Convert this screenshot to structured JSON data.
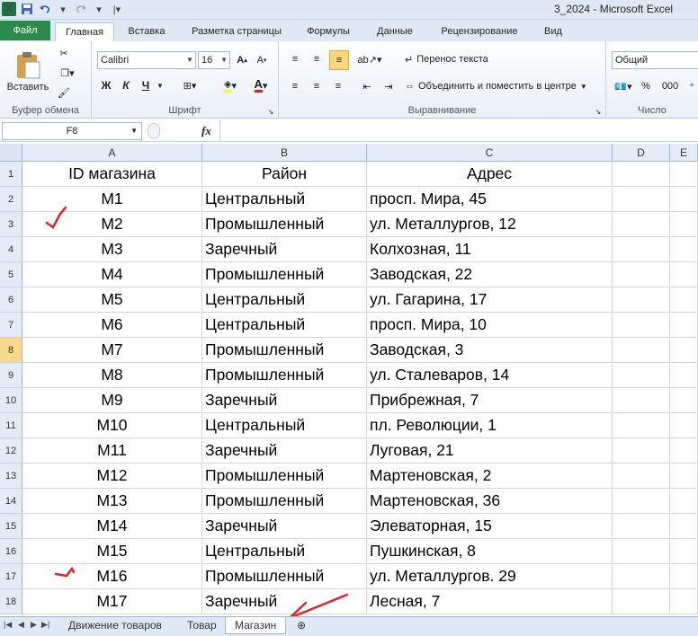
{
  "window": {
    "title": "3_2024  -  Microsoft Excel"
  },
  "qat": {
    "app_icon": "X",
    "save_icon": "save-icon",
    "undo_icon": "undo-icon",
    "redo_icon": "redo-icon"
  },
  "tabs": {
    "file": "Файл",
    "home": "Главная",
    "insert": "Вставка",
    "layout": "Разметка страницы",
    "formulas": "Формулы",
    "data": "Данные",
    "review": "Рецензирование",
    "view": "Вид"
  },
  "ribbon": {
    "clipboard": {
      "label": "Буфер обмена",
      "paste": "Вставить"
    },
    "font": {
      "label": "Шрифт",
      "family": "Calibri",
      "size": "16",
      "bold": "Ж",
      "italic": "К",
      "underline": "Ч"
    },
    "alignment": {
      "label": "Выравнивание",
      "wrap": "Перенос текста",
      "merge": "Объединить и поместить в центре"
    },
    "number": {
      "label": "Число",
      "format": "Общий",
      "percent": "%",
      "thousands": "000"
    }
  },
  "formula_bar": {
    "name_box": "F8",
    "fx": "fx",
    "value": ""
  },
  "columns": [
    "A",
    "B",
    "C",
    "D",
    "E"
  ],
  "rows": [
    {
      "n": "1",
      "a": "ID магазина",
      "b": "Район",
      "c": "Адрес"
    },
    {
      "n": "2",
      "a": "M1",
      "b": "Центральный",
      "c": "просп. Мира, 45"
    },
    {
      "n": "3",
      "a": "M2",
      "b": "Промышленный",
      "c": "ул. Металлургов, 12"
    },
    {
      "n": "4",
      "a": "M3",
      "b": "Заречный",
      "c": "Колхозная, 11"
    },
    {
      "n": "5",
      "a": "M4",
      "b": "Промышленный",
      "c": "Заводская, 22"
    },
    {
      "n": "6",
      "a": "M5",
      "b": "Центральный",
      "c": "ул. Гагарина, 17"
    },
    {
      "n": "7",
      "a": "M6",
      "b": "Центральный",
      "c": "просп. Мира, 10"
    },
    {
      "n": "8",
      "a": "M7",
      "b": "Промышленный",
      "c": "Заводская, 3"
    },
    {
      "n": "9",
      "a": "M8",
      "b": "Промышленный",
      "c": "ул. Сталеваров, 14"
    },
    {
      "n": "10",
      "a": "M9",
      "b": "Заречный",
      "c": "Прибрежная, 7"
    },
    {
      "n": "11",
      "a": "M10",
      "b": "Центральный",
      "c": "пл. Революции, 1"
    },
    {
      "n": "12",
      "a": "M11",
      "b": "Заречный",
      "c": "Луговая, 21"
    },
    {
      "n": "13",
      "a": "M12",
      "b": "Промышленный",
      "c": "Мартеновская, 2"
    },
    {
      "n": "14",
      "a": "M13",
      "b": "Промышленный",
      "c": "Мартеновская, 36"
    },
    {
      "n": "15",
      "a": "M14",
      "b": "Заречный",
      "c": "Элеваторная, 15"
    },
    {
      "n": "16",
      "a": "M15",
      "b": "Центральный",
      "c": "Пушкинская, 8"
    },
    {
      "n": "17",
      "a": "M16",
      "b": "Промышленный",
      "c": "ул. Металлургов. 29"
    },
    {
      "n": "18",
      "a": "M17",
      "b": "Заречный",
      "c": "Лесная, 7"
    }
  ],
  "selected_row": "8",
  "sheets": [
    "Движение товаров",
    "Товар",
    "Магазин"
  ],
  "active_sheet": "Магазин",
  "annotation_color": "#e0242c"
}
